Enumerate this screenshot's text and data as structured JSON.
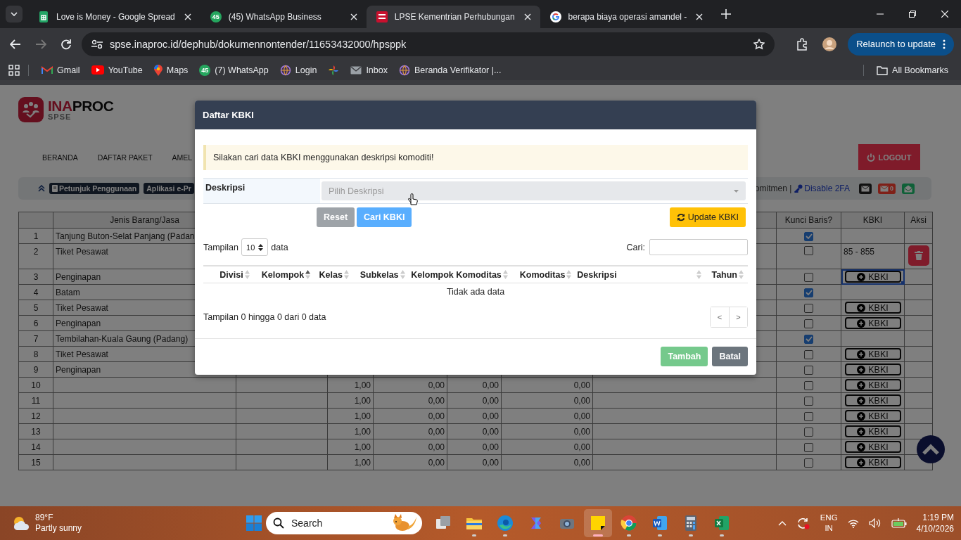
{
  "browser": {
    "tabs": [
      {
        "title": "Love is Money - Google Spread",
        "kind": "sheets",
        "selected": false
      },
      {
        "title": "(45) WhatsApp Business",
        "kind": "whatsapp",
        "badge": "45",
        "selected": false
      },
      {
        "title": "LPSE Kementrian Perhubungan",
        "kind": "site",
        "selected": true
      },
      {
        "title": "berapa biaya operasi amandel -",
        "kind": "google",
        "selected": false
      }
    ],
    "address": "spse.inaproc.id/dephub/dokumennontender/11653432000/hpsppk",
    "relaunch": "Relaunch to update",
    "bookmarks": [
      {
        "label": "Gmail",
        "kind": "gmail"
      },
      {
        "label": "YouTube",
        "kind": "youtube"
      },
      {
        "label": "Maps",
        "kind": "maps"
      },
      {
        "label": "(7) WhatsApp",
        "kind": "whatsapp",
        "badge": "45"
      },
      {
        "label": "Login",
        "kind": "globe"
      },
      {
        "kind": "pinwheel"
      },
      {
        "label": "Inbox",
        "kind": "envelope"
      },
      {
        "label": "Beranda Verifikator |...",
        "kind": "globe"
      }
    ],
    "all_bookmarks": "All Bookmarks"
  },
  "page": {
    "logo": {
      "text_1": "INA",
      "text_2": "PROC",
      "subtitle": "SPSE"
    },
    "nav": [
      "BERANDA",
      "DAFTAR PAKET",
      "AMEL"
    ],
    "logout": "LOGOUT",
    "toolbar": {
      "links": [
        "Petunjuk Penggunaan",
        "Aplikasi e-Pr"
      ],
      "note": "omitmen |",
      "twofa": "Disable 2FA",
      "mail_count": "0"
    },
    "table": {
      "columns": [
        "Jenis Barang/Jasa",
        "Kunci Baris?",
        "KBKI",
        "Aksi"
      ],
      "rows": [
        {
          "no": "1",
          "name": "Tanjung Buton-Selat Panjang (Padan",
          "locked": true,
          "deletable": false,
          "focused": false
        },
        {
          "no": "2",
          "name": "Tiket Pesawat",
          "locked": false,
          "kbki": "85 - 855",
          "deletable": true,
          "focused": false
        },
        {
          "no": "3",
          "name": "Penginapan",
          "locked": false,
          "button": "KBKI",
          "deletable": false,
          "focused": true
        },
        {
          "no": "4",
          "name": "Batam",
          "locked": true,
          "deletable": false,
          "focused": false
        },
        {
          "no": "5",
          "name": "Tiket Pesawat",
          "locked": false,
          "button": "KBKI",
          "deletable": false,
          "focused": false
        },
        {
          "no": "6",
          "name": "Penginapan",
          "locked": false,
          "button": "KBKI",
          "deletable": false,
          "focused": false
        },
        {
          "no": "7",
          "name": "Tembilahan-Kuala Gaung (Padang)",
          "locked": true,
          "deletable": false,
          "focused": false
        },
        {
          "no": "8",
          "name": "Tiket Pesawat",
          "locked": false,
          "button": "KBKI",
          "deletable": false,
          "focused": false
        },
        {
          "no": "9",
          "name": "Penginapan",
          "locked": false,
          "button": "KBKI",
          "deletable": false,
          "focused": false
        },
        {
          "no": "10",
          "values": [
            "1,00",
            "0,00",
            "0,00",
            "0,00"
          ],
          "locked": false,
          "button": "KBKI",
          "deletable": false,
          "focused": false
        },
        {
          "no": "11",
          "values": [
            "1,00",
            "0,00",
            "0,00",
            "0,00"
          ],
          "locked": false,
          "button": "KBKI",
          "deletable": false,
          "focused": false
        },
        {
          "no": "12",
          "values": [
            "1,00",
            "0,00",
            "0,00",
            "0,00"
          ],
          "locked": false,
          "button": "KBKI",
          "deletable": false,
          "focused": false
        },
        {
          "no": "13",
          "values": [
            "1,00",
            "0,00",
            "0,00",
            "0,00"
          ],
          "locked": false,
          "button": "KBKI",
          "deletable": false,
          "focused": false
        },
        {
          "no": "14",
          "values": [
            "1,00",
            "0,00",
            "0,00",
            "0,00"
          ],
          "locked": false,
          "button": "KBKI",
          "deletable": false,
          "focused": false
        },
        {
          "no": "15",
          "values": [
            "1,00",
            "0,00",
            "0,00",
            "0,00"
          ],
          "locked": false,
          "button": "KBKI",
          "deletable": false,
          "focused": false
        }
      ]
    }
  },
  "modal": {
    "title": "Daftar KBKI",
    "alert": "Silakan cari data KBKI menggunakan deskripsi komoditi!",
    "field_label": "Deskripsi",
    "placeholder": "Pilih Deskripsi",
    "buttons": {
      "reset": "Reset",
      "search": "Cari KBKI",
      "update": "Update KBKI"
    },
    "length": {
      "before": "Tampilan",
      "value": "10",
      "after": "data"
    },
    "search_label": "Cari:",
    "columns": [
      {
        "label": "Divisi",
        "sorted": false
      },
      {
        "label": "Kelompok",
        "sorted": true
      },
      {
        "label": "Kelas",
        "sorted": false
      },
      {
        "label": "Subkelas",
        "sorted": false
      },
      {
        "label": "Kelompok Komoditas",
        "sorted": false
      },
      {
        "label": "Komoditas",
        "sorted": false
      },
      {
        "label": "Deskripsi",
        "sorted": false
      },
      {
        "label": "Tahun",
        "sorted": false
      }
    ],
    "empty": "Tidak ada data",
    "info": "Tampilan 0 hingga 0 dari 0 data",
    "pager": [
      "<",
      ">"
    ],
    "footer": [
      {
        "label": "Tambah",
        "kind": "add",
        "disabled": true
      },
      {
        "label": "Batal",
        "kind": "cancel",
        "disabled": false
      }
    ]
  },
  "taskbar": {
    "temperature": "89°F",
    "weather": "Partly sunny",
    "search": "Search",
    "apps": [
      {
        "kind": "taskview",
        "running": false,
        "active": false
      },
      {
        "kind": "folder",
        "running": true,
        "active": false
      },
      {
        "kind": "edge",
        "running": true,
        "active": false
      },
      {
        "kind": "copilot",
        "running": false,
        "active": false
      },
      {
        "kind": "camera",
        "running": false,
        "active": false
      },
      {
        "kind": "notes",
        "running": true,
        "active": true
      },
      {
        "kind": "chrome",
        "running": true,
        "active": false
      },
      {
        "kind": "word",
        "running": true,
        "active": false
      },
      {
        "kind": "calc",
        "running": true,
        "active": false
      },
      {
        "kind": "excel",
        "running": true,
        "active": false
      }
    ],
    "lang": "ENG",
    "region": "IN",
    "time": "1:19 PM",
    "date": "4/10/2026"
  }
}
